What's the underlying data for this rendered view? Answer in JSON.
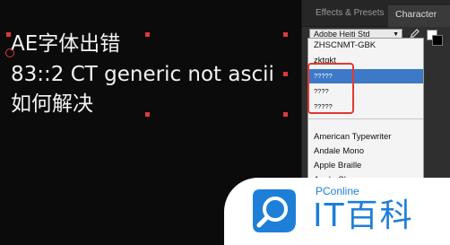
{
  "composition": {
    "lines": [
      "AE字体出错",
      "83::2 CT generic not ascii",
      "如何解决"
    ]
  },
  "panel": {
    "tabs": [
      {
        "label": "Effects & Presets"
      },
      {
        "label": "Character"
      }
    ],
    "font_select": {
      "value": "Adobe Heiti Std"
    },
    "font_list": [
      "ZHSCNMT-GBK",
      "zktqkt",
      "?????",
      "????",
      "?????",
      "American Typewriter",
      "Andale Mono",
      "Apple Braille",
      "Apple Chancery"
    ]
  },
  "watermark": {
    "brand": "PConline",
    "title": "IT百科"
  },
  "colors": {
    "accent_selection": "#3d79c7",
    "annotation_red": "#e03a2f",
    "watermark_blue": "#1e7fd8"
  }
}
